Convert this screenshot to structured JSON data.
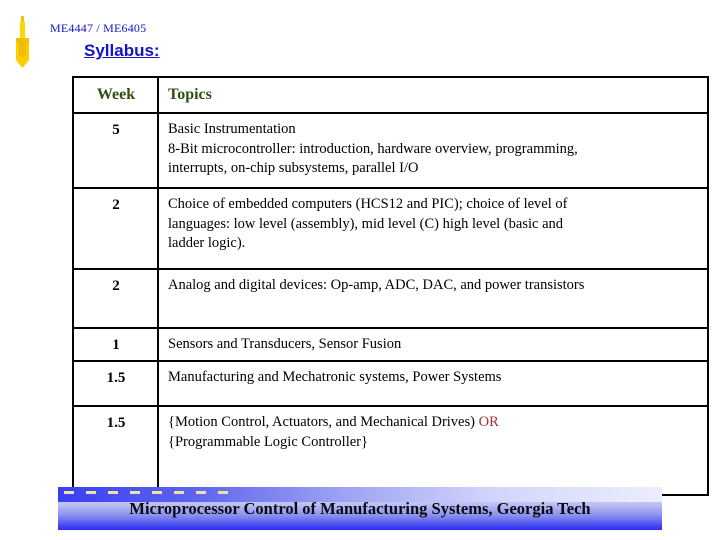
{
  "slide": {
    "course_code": "ME4447 / ME6405",
    "heading": "Syllabus:",
    "bullet_icon": "yellow-arrow-icon"
  },
  "table": {
    "headers": {
      "week": "Week",
      "topics": "Topics"
    },
    "rows": [
      {
        "week": "5",
        "lines": [
          "Basic Instrumentation",
          "8-Bit microcontroller: introduction, hardware overview, programming,",
          "interrupts, on-chip subsystems, parallel I/O"
        ]
      },
      {
        "week": "2",
        "lines": [
          "Choice of embedded computers (HCS12 and PIC); choice of level of",
          "languages: low level (assembly), mid level (C) high level (basic and",
          "ladder logic)."
        ]
      },
      {
        "week": "2",
        "lines": [
          "Analog and digital devices: Op-amp, ADC, DAC, and power transistors"
        ]
      },
      {
        "week": "1",
        "lines": [
          "Sensors and Transducers, Sensor Fusion"
        ]
      },
      {
        "week": "1.5",
        "lines": [
          "Manufacturing and  Mechatronic systems, Power Systems"
        ]
      },
      {
        "week": "1.5",
        "lines_split": {
          "line1_main": "{Motion Control, Actuators, and Mechanical Drives) ",
          "line1_accent": "OR",
          "line2": "{Programmable Logic Controller}"
        }
      }
    ]
  },
  "footer": {
    "text": "Microprocessor Control of Manufacturing Systems, Georgia Tech"
  },
  "colors": {
    "title_blue": "#1414c8",
    "header_green": "#2f4f12",
    "accent_red": "#a03040",
    "bullet_yellow": "#ffcc00",
    "banner_blue": "#2b2bf5"
  }
}
